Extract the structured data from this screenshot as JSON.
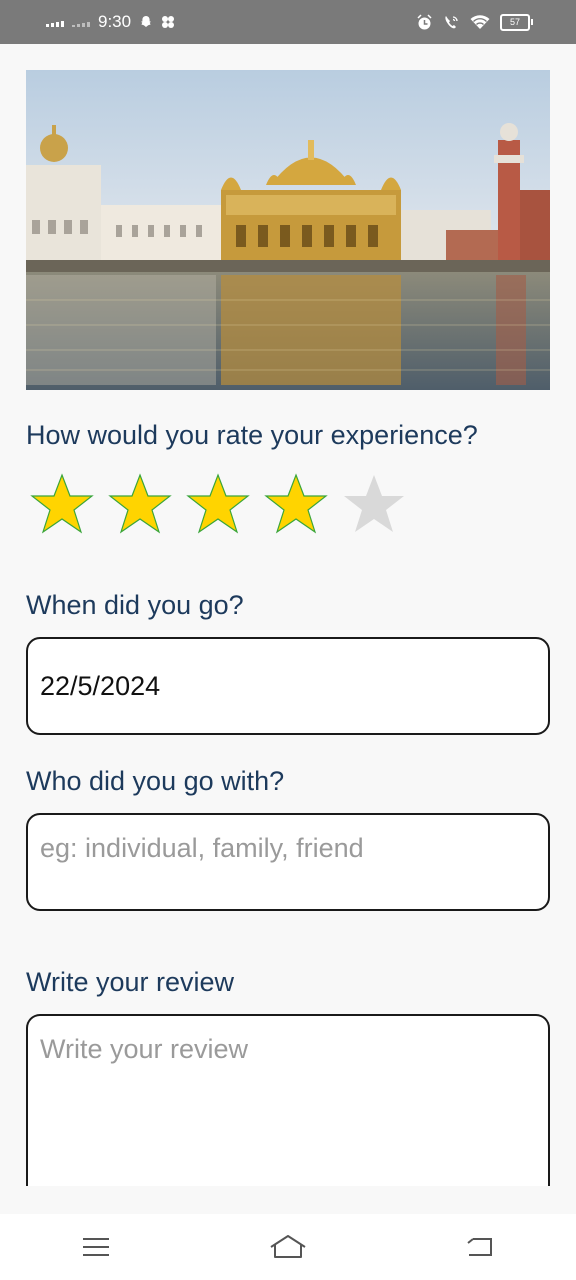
{
  "status_bar": {
    "time": "9:30",
    "battery": "57",
    "icons_left": [
      "signal-icon",
      "signal-weak-icon",
      "snapchat-icon",
      "pinwheel-icon"
    ],
    "icons_right": [
      "alarm-icon",
      "wifi-call-icon",
      "wifi-icon",
      "battery-icon"
    ]
  },
  "hero_image": {
    "subject": "golden-temple-photo"
  },
  "rating": {
    "question": "How would you rate your experience?",
    "value": 4,
    "max": 5,
    "filled_color": "#ffd400",
    "empty_color": "#d9d9d9"
  },
  "date_section": {
    "label": "When did you go?",
    "value": "22/5/2024"
  },
  "companion_section": {
    "label": "Who did you go with?",
    "placeholder": "eg: individual, family, friend"
  },
  "review_section": {
    "label": "Write your review",
    "placeholder": "Write your review"
  },
  "nav_bar": {
    "icons": [
      "menu-icon",
      "home-icon",
      "back-icon"
    ]
  }
}
